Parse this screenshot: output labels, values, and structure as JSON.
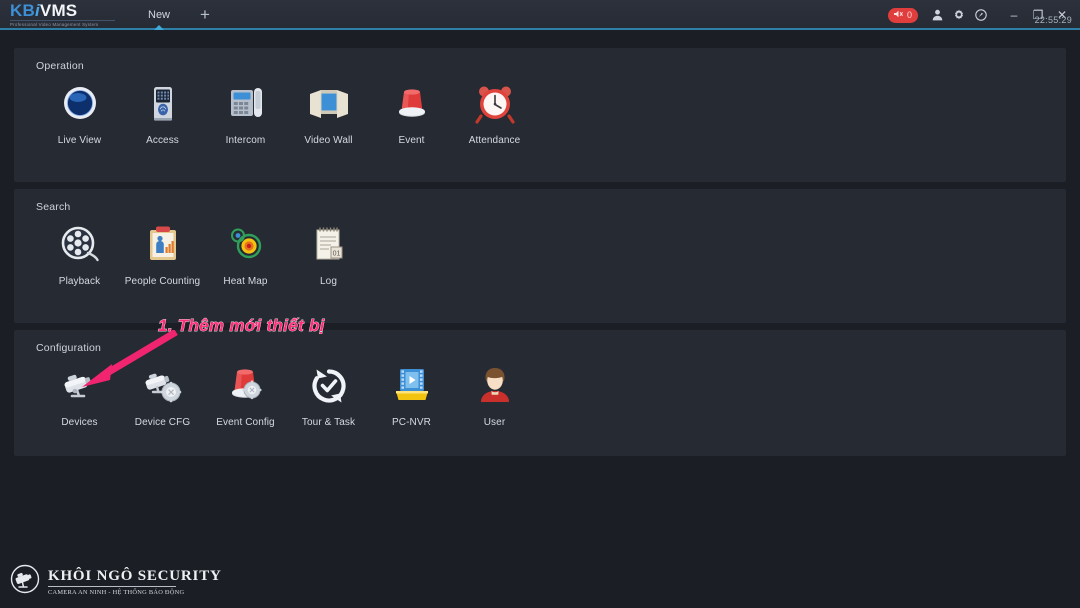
{
  "titlebar": {
    "logo_main_kb": "KB",
    "logo_main_i": "i",
    "logo_main_vms": "VMS",
    "logo_subtitle": "Professional Video Management System",
    "tab_new": "New",
    "tab_add": "+",
    "alarm_count": "0",
    "alarm_icon": "speaker-mute-icon",
    "user_icon": "user-icon",
    "settings_icon": "gear-icon",
    "help_icon": "help-icon",
    "minimize": "–",
    "maximize": "❐",
    "close": "✕",
    "clock": "22:55:29",
    "accent_color": "#2d7fa8"
  },
  "sections": [
    {
      "title": "Operation",
      "items": [
        {
          "label": "Live View",
          "icon": "live-view-icon"
        },
        {
          "label": "Access",
          "icon": "access-control-icon"
        },
        {
          "label": "Intercom",
          "icon": "intercom-phone-icon"
        },
        {
          "label": "Video Wall",
          "icon": "video-wall-icon"
        },
        {
          "label": "Event",
          "icon": "alarm-light-icon"
        },
        {
          "label": "Attendance",
          "icon": "alarm-clock-icon"
        }
      ]
    },
    {
      "title": "Search",
      "items": [
        {
          "label": "Playback",
          "icon": "film-reel-icon"
        },
        {
          "label": "People Counting",
          "icon": "clipboard-person-icon"
        },
        {
          "label": "Heat Map",
          "icon": "heat-map-icon"
        },
        {
          "label": "Log",
          "icon": "notepad-log-icon"
        }
      ]
    },
    {
      "title": "Configuration",
      "items": [
        {
          "label": "Devices",
          "icon": "camera-icon"
        },
        {
          "label": "Device CFG",
          "icon": "camera-gear-icon"
        },
        {
          "label": "Event Config",
          "icon": "alarm-light-gear-icon"
        },
        {
          "label": "Tour & Task",
          "icon": "refresh-check-icon"
        },
        {
          "label": "PC-NVR",
          "icon": "pc-nvr-icon"
        },
        {
          "label": "User",
          "icon": "user-avatar-icon"
        }
      ]
    }
  ],
  "annotation": {
    "text": "1. Thêm mới thiết bị",
    "color": "#ff2d78",
    "arrow": "pink-arrow-pointing-to-devices"
  },
  "watermark": {
    "title": "KHÔI  NGÔ SECURITY",
    "subtitle": "CAMERA AN NINH - HỆ THỐNG BÁO ĐỘNG",
    "icon": "cctv-camera-logo-icon"
  }
}
